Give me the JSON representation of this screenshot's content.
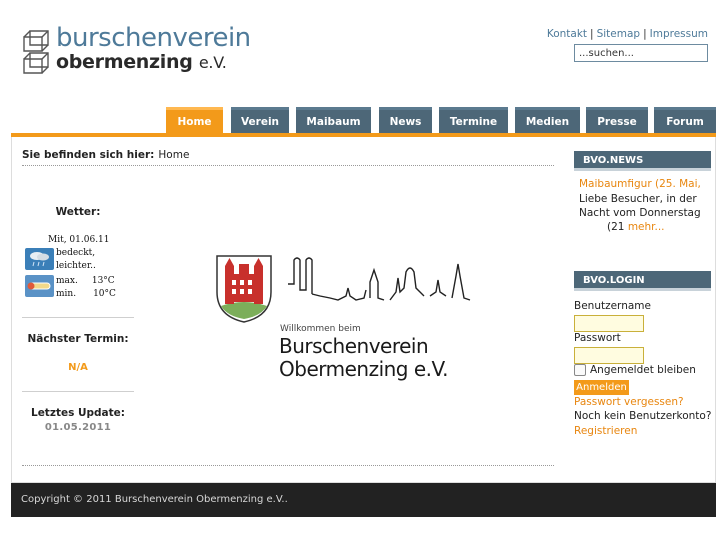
{
  "header": {
    "logo_line1": "burschenverein",
    "logo_line2": "obermenzing",
    "logo_line2_suffix": "e.V.",
    "links": [
      "Kontakt",
      "Sitemap",
      "Impressum"
    ],
    "search_placeholder": "...suchen..."
  },
  "nav": {
    "tabs": [
      {
        "label": "Home",
        "active": true
      },
      {
        "label": "Verein",
        "active": false
      },
      {
        "label": "Maibaum",
        "active": false
      },
      {
        "label": "News",
        "active": false
      },
      {
        "label": "Termine",
        "active": false
      },
      {
        "label": "Medien",
        "active": false
      },
      {
        "label": "Presse",
        "active": false
      },
      {
        "label": "Forum",
        "active": false
      }
    ]
  },
  "breadcrumb": {
    "prefix": "Sie befinden sich hier:",
    "current": "Home"
  },
  "weather": {
    "heading": "Wetter:",
    "date": "Mit, 01.06.11",
    "condition_line1": "bedeckt,",
    "condition_line2": "leichter..",
    "max_label": "max.",
    "max_value": "13°C",
    "min_label": "min.",
    "min_value": "10°C",
    "icons": [
      "cloud-rain-icon",
      "thermometer-icon"
    ]
  },
  "next_event": {
    "heading": "Nächster Termin:",
    "value": "N/A"
  },
  "last_update": {
    "heading": "Letztes Update:",
    "value": "01.05.2011"
  },
  "welcome": {
    "small": "Willkommen beim",
    "line1": "Burschenverein",
    "line2": "Obermenzing e.V."
  },
  "news": {
    "heading": "BVO.NEWS",
    "line1": "Maibaumfigur (25. Mai,",
    "line2": "Liebe Besucher, in der",
    "line3": "Nacht vom Donnerstag",
    "line4_prefix": "(21",
    "more": "mehr..."
  },
  "login": {
    "heading": "BVO.LOGIN",
    "username_label": "Benutzername",
    "password_label": "Passwort",
    "remember_label": "Angemeldet bleiben",
    "submit_label": "Anmelden",
    "forgot_link": "Passwort vergessen?",
    "no_account": "Noch kein Benutzerkonto?",
    "register_link": "Registrieren"
  },
  "footer": {
    "copyright": "Copyright © 2011 Burschenverein Obermenzing e.V.."
  },
  "colors": {
    "accent_orange": "#f39a1a",
    "nav_slate": "#4d6778",
    "logo_blue": "#4e7a99",
    "footer_dark": "#222222"
  }
}
